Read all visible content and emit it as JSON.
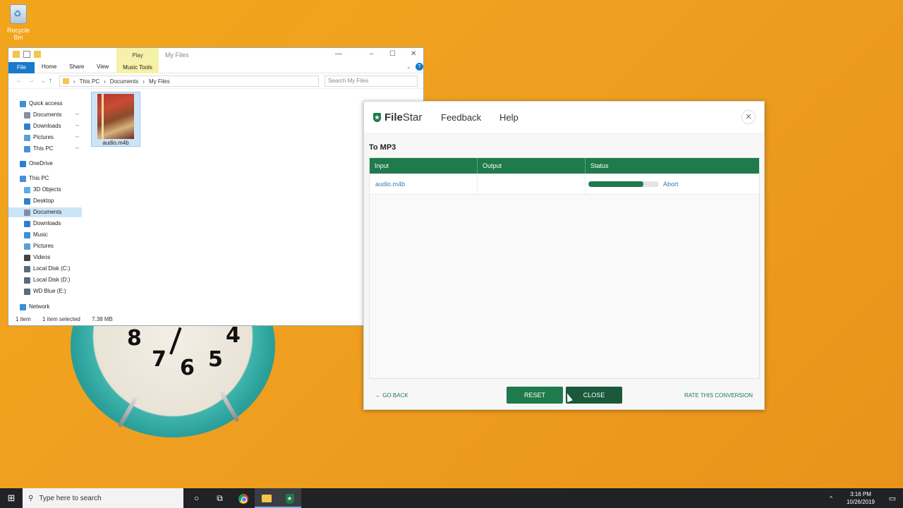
{
  "desktop": {
    "recycle_label": "Recycle Bin"
  },
  "explorer": {
    "play_tab": "Play",
    "window_title": "My Files",
    "ribbon": {
      "file": "File",
      "home": "Home",
      "share": "Share",
      "view": "View",
      "music_tools": "Music Tools"
    },
    "breadcrumb": [
      "This PC",
      "Documents",
      "My Files"
    ],
    "search_placeholder": "Search My Files",
    "sidebar": [
      {
        "label": "Quick access",
        "icon": "star-icon",
        "color": "#3a8fd8"
      },
      {
        "label": "Documents",
        "icon": "documents-icon",
        "color": "#7f8fa6",
        "pinned": true
      },
      {
        "label": "Downloads",
        "icon": "download-icon",
        "color": "#2f7fd0",
        "pinned": true
      },
      {
        "label": "Pictures",
        "icon": "pictures-icon",
        "color": "#5aa0d8",
        "pinned": true
      },
      {
        "label": "This PC",
        "icon": "pc-icon",
        "color": "#4a90d9",
        "pinned": true
      },
      {
        "label": "OneDrive",
        "icon": "cloud-icon",
        "color": "#2a7fd4"
      },
      {
        "label": "This PC",
        "icon": "pc-icon",
        "color": "#4a90d9"
      },
      {
        "label": "3D Objects",
        "icon": "cube-icon",
        "color": "#5aaee8"
      },
      {
        "label": "Desktop",
        "icon": "desktop-icon",
        "color": "#2f7fd0"
      },
      {
        "label": "Documents",
        "icon": "documents-icon",
        "color": "#7f8fa6",
        "selected": true
      },
      {
        "label": "Downloads",
        "icon": "download-icon",
        "color": "#2f7fd0"
      },
      {
        "label": "Music",
        "icon": "music-icon",
        "color": "#3a8fd8"
      },
      {
        "label": "Pictures",
        "icon": "pictures-icon",
        "color": "#5aa0d8"
      },
      {
        "label": "Videos",
        "icon": "video-icon",
        "color": "#444"
      },
      {
        "label": "Local Disk (C:)",
        "icon": "drive-icon",
        "color": "#5b6b7b"
      },
      {
        "label": "Local Disk (D:)",
        "icon": "drive-icon",
        "color": "#5b6b7b"
      },
      {
        "label": "WD Blue (E:)",
        "icon": "drive-icon",
        "color": "#5b6b7b"
      },
      {
        "label": "Network",
        "icon": "network-icon",
        "color": "#3a8fd8"
      }
    ],
    "file": {
      "name": "audio.m4b"
    },
    "status": {
      "items": "1 item",
      "selected": "1 item selected",
      "size": "7.38 MB"
    }
  },
  "filestar": {
    "logo_file": "File",
    "logo_star": "Star",
    "nav": {
      "feedback": "Feedback",
      "help": "Help"
    },
    "section_title": "To MP3",
    "columns": [
      "Input",
      "Output",
      "Status"
    ],
    "rows": [
      {
        "input": "audio.m4b",
        "output": "",
        "progress": 0.8,
        "action": "Abort"
      }
    ],
    "footer": {
      "go_back": "GO BACK",
      "reset": "RESET",
      "close": "CLOSE",
      "rate": "RATE THIS CONVERSION"
    },
    "accent": "#1f7a4c"
  },
  "taskbar": {
    "search_placeholder": "Type here to search",
    "time": "3:16 PM",
    "date": "10/26/2019"
  }
}
